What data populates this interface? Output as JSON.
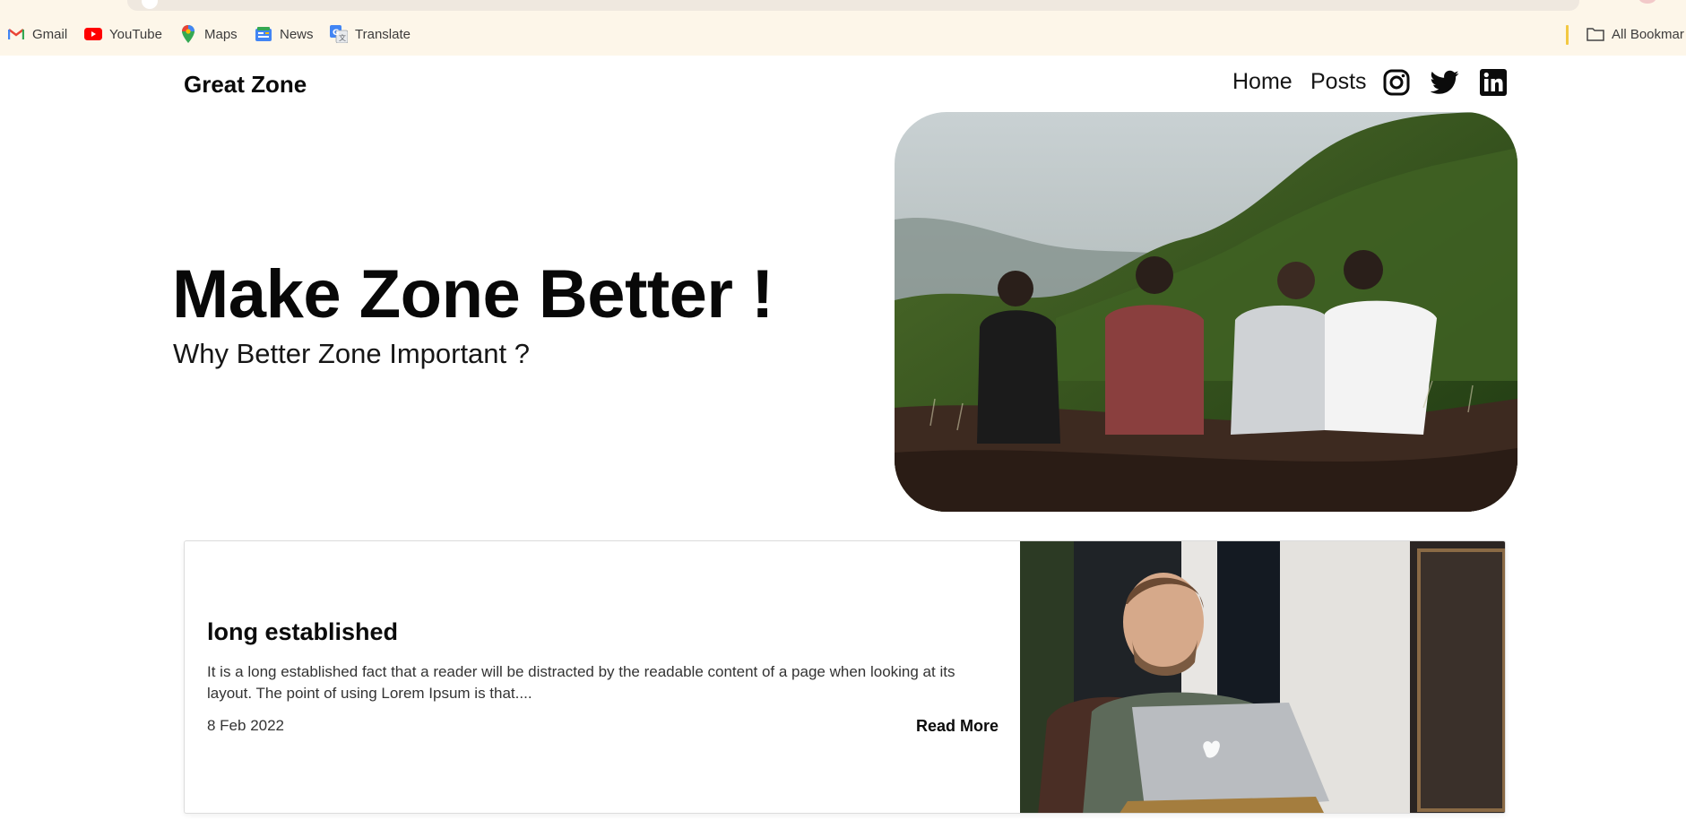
{
  "browser": {
    "bookmarks": [
      {
        "label": "Gmail",
        "icon": "gmail-icon"
      },
      {
        "label": "YouTube",
        "icon": "youtube-icon"
      },
      {
        "label": "Maps",
        "icon": "maps-icon"
      },
      {
        "label": "News",
        "icon": "news-icon"
      },
      {
        "label": "Translate",
        "icon": "translate-icon"
      }
    ],
    "all_bookmarks_label": "All Bookmar"
  },
  "site": {
    "title": "Great Zone",
    "nav": [
      {
        "label": "Home"
      },
      {
        "label": "Posts"
      }
    ],
    "social_icons": [
      "instagram-icon",
      "twitter-icon",
      "linkedin-icon"
    ]
  },
  "hero": {
    "title": "Make Zone Better !",
    "subtitle": "Why Better Zone Important ?",
    "image": "friends-on-mountain-photo"
  },
  "post": {
    "title": "long established",
    "excerpt": "It is a long established fact that a reader will be distracted by the readable content of a page when looking at its layout. The point of using Lorem Ipsum is that....",
    "date": "8 Feb 2022",
    "read_more": "Read More",
    "image": "man-with-laptop-photo"
  },
  "colors": {
    "chrome_bg": "#fdf6e9",
    "text": "#0b0b0b",
    "card_border": "#dcdcdc"
  }
}
